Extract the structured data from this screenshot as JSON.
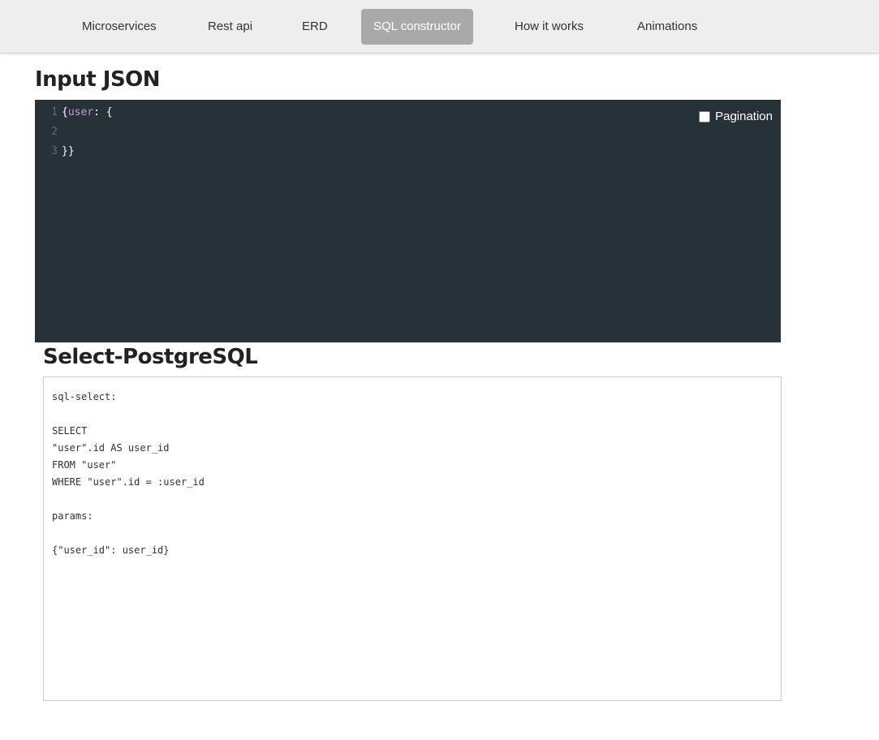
{
  "nav": {
    "items": [
      {
        "label": "Microservices"
      },
      {
        "label": "Rest api"
      },
      {
        "label": "ERD"
      },
      {
        "label": "SQL constructor",
        "active": true
      },
      {
        "label": "How it works"
      },
      {
        "label": "Animations"
      }
    ]
  },
  "input_section": {
    "title": "Input JSON",
    "pagination_label": "Pagination",
    "pagination_checked": false,
    "lines": [
      {
        "num": "1",
        "open": "{",
        "key": "user",
        "rest": ": {"
      },
      {
        "num": "2",
        "text": ""
      },
      {
        "num": "3",
        "text": "}}"
      }
    ]
  },
  "output_section": {
    "title": "Select-PostgreSQL",
    "text": "sql-select:\n\nSELECT\n\"user\".id AS user_id\nFROM \"user\"\nWHERE \"user\".id = :user_id\n\nparams:\n\n{\"user_id\": user_id}"
  },
  "colors": {
    "editor_bg": "#263238",
    "active_tab_bg": "#a9a9a9",
    "json_key": "#c792ea"
  }
}
